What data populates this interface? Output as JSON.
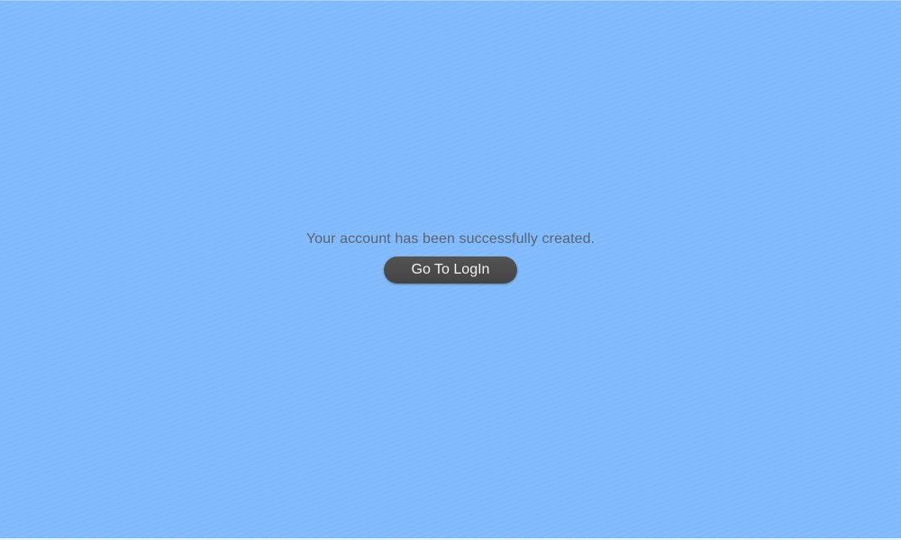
{
  "confirmation": {
    "message": "Your account has been successfully created.",
    "button_label": "Go To LogIn"
  },
  "colors": {
    "background": "#80bafc",
    "message_text": "#5a6470",
    "button_background": "#4a4a4a",
    "button_text": "#f2f2f2"
  }
}
